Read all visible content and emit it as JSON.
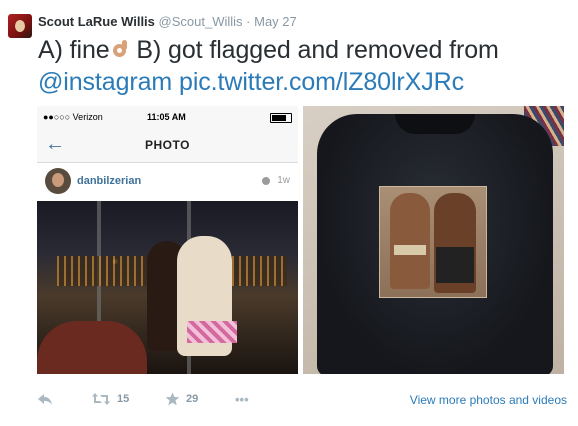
{
  "tweet": {
    "author_name": "Scout LaRue Willis",
    "screen_name": "@Scout_Willis",
    "separator": "·",
    "date": "May 27",
    "text_part1": "A) fine",
    "text_part2": " B) got flagged and removed from ",
    "mention": "@instagram",
    "link": "pic.twitter.com/lZ80lrXJRc",
    "emoji_icon": "ok-hand-emoji"
  },
  "phone_screenshot": {
    "carrier": "●●○○○ Verizon",
    "time": "11:05 AM",
    "title": "PHOTO",
    "username": "danbilzerian",
    "age": "1w"
  },
  "actions": {
    "retweet_count": "15",
    "favorite_count": "29",
    "more_label": "•••",
    "view_more_label": "View more photos and videos"
  },
  "colors": {
    "link": "#2b7bb9",
    "muted": "#8899a6",
    "text": "#292f33"
  }
}
